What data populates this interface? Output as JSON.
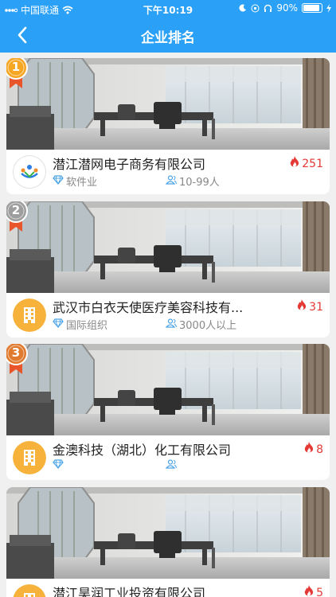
{
  "status_bar": {
    "carrier": "中国联通",
    "time": "下午10:19",
    "battery": "90%",
    "battery_level": 0.9
  },
  "nav": {
    "title": "企业排名",
    "back_icon": "chevron-left-icon"
  },
  "companies": [
    {
      "rank": "1",
      "name": "潜江潜网电子商务有限公司",
      "heat": "251",
      "industry": "软件业",
      "size": "10-99人",
      "logo": "network-logo",
      "badge_color": "#f5a623"
    },
    {
      "rank": "2",
      "name": "武汉市白衣天使医疗美容科技有...",
      "heat": "31",
      "industry": "国际组织",
      "size": "3000人以上",
      "logo": "building-logo",
      "badge_color": "#9e9e9e"
    },
    {
      "rank": "3",
      "name": "金澳科技（湖北）化工有限公司",
      "heat": "8",
      "industry": "",
      "size": "",
      "logo": "building-logo",
      "badge_color": "#e07a2e"
    },
    {
      "rank": "",
      "name": "潜江昊润工业投资有限公司",
      "heat": "5",
      "industry": "",
      "size": "",
      "logo": "building-logo",
      "badge_color": ""
    }
  ],
  "colors": {
    "primary": "#2aa1f6",
    "heat": "#e53935",
    "building_logo": "#f6b23a",
    "meta_icon": "#4aa3e6"
  }
}
